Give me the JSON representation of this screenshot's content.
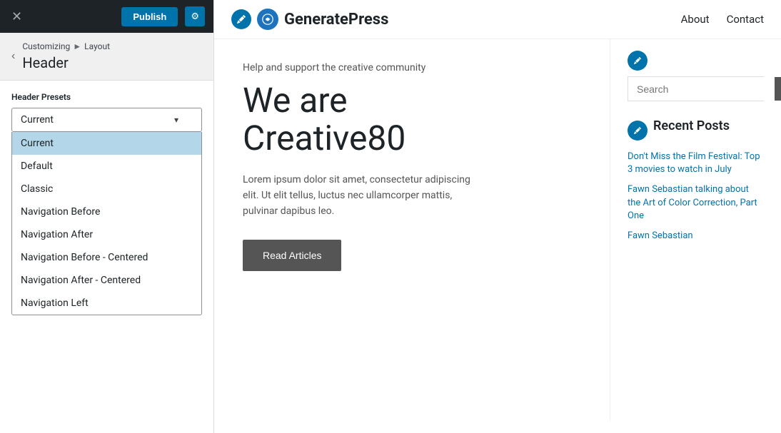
{
  "topbar": {
    "close_label": "✕",
    "publish_label": "Publish",
    "settings_label": "⚙"
  },
  "panel": {
    "breadcrumb_root": "Customizing",
    "breadcrumb_sep": "►",
    "breadcrumb_current": "Layout",
    "title": "Header",
    "section_label": "Header Presets",
    "back_icon": "‹"
  },
  "dropdown": {
    "selected": "Current",
    "chevron": "▾",
    "options": [
      {
        "value": "current",
        "label": "Current",
        "active": true
      },
      {
        "value": "default",
        "label": "Default",
        "active": false
      },
      {
        "value": "classic",
        "label": "Classic",
        "active": false
      },
      {
        "value": "nav-before",
        "label": "Navigation Before",
        "active": false
      },
      {
        "value": "nav-after",
        "label": "Navigation After",
        "active": false
      },
      {
        "value": "nav-before-centered",
        "label": "Navigation Before - Centered",
        "active": false
      },
      {
        "value": "nav-after-centered",
        "label": "Navigation After - Centered",
        "active": false
      },
      {
        "value": "nav-left",
        "label": "Navigation Left",
        "active": false
      }
    ]
  },
  "site": {
    "logo_text": "GeneratePress",
    "logo_icon": "G",
    "nav_items": [
      "About",
      "Contact"
    ],
    "hero_subtitle": "Help and support the creative community",
    "hero_title_line1": "We are",
    "hero_title_line2": "Creative80",
    "hero_body": "Lorem ipsum dolor sit amet, consectetur adipiscing elit. Ut elit tellus, luctus nec ullamcorper mattis, pulvinar dapibus leo.",
    "read_btn_label": "Read Articles",
    "search_placeholder": "Search",
    "search_submit_icon": "🔍",
    "recent_posts_title": "Recent Posts",
    "recent_posts": [
      "Don't Miss the Film Festival: Top 3 movies to watch in July",
      "Fawn Sebastian talking about the Art of Color Correction, Part One",
      "Fawn Sebastian"
    ]
  }
}
